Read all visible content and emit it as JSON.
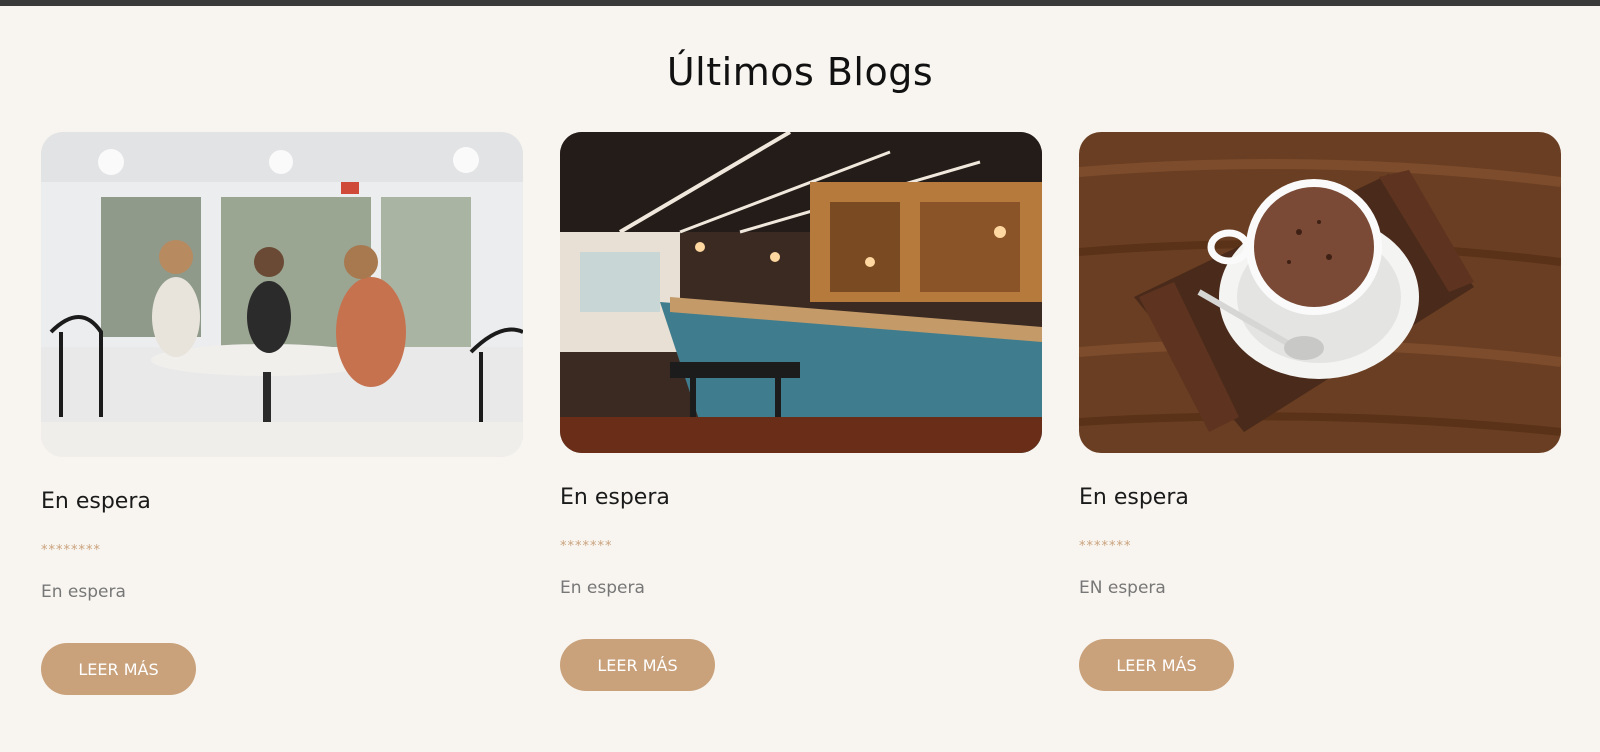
{
  "section": {
    "title": "Últimos Blogs"
  },
  "cards": [
    {
      "title": "En espera",
      "stars": "********",
      "excerpt": "En espera",
      "button": "LEER MÁS",
      "image": "cafe-friends-photo"
    },
    {
      "title": "En espera",
      "stars": "*******",
      "excerpt": "En espera",
      "button": "LEER MÁS",
      "image": "bakery-counter-photo"
    },
    {
      "title": "En espera",
      "stars": "*******",
      "excerpt": "EN espera",
      "button": "LEER MÁS",
      "image": "hot-chocolate-photo"
    }
  ],
  "colors": {
    "background": "#f8f5f0",
    "accent": "#c9a27c",
    "title": "#111111",
    "muted": "#777777"
  }
}
